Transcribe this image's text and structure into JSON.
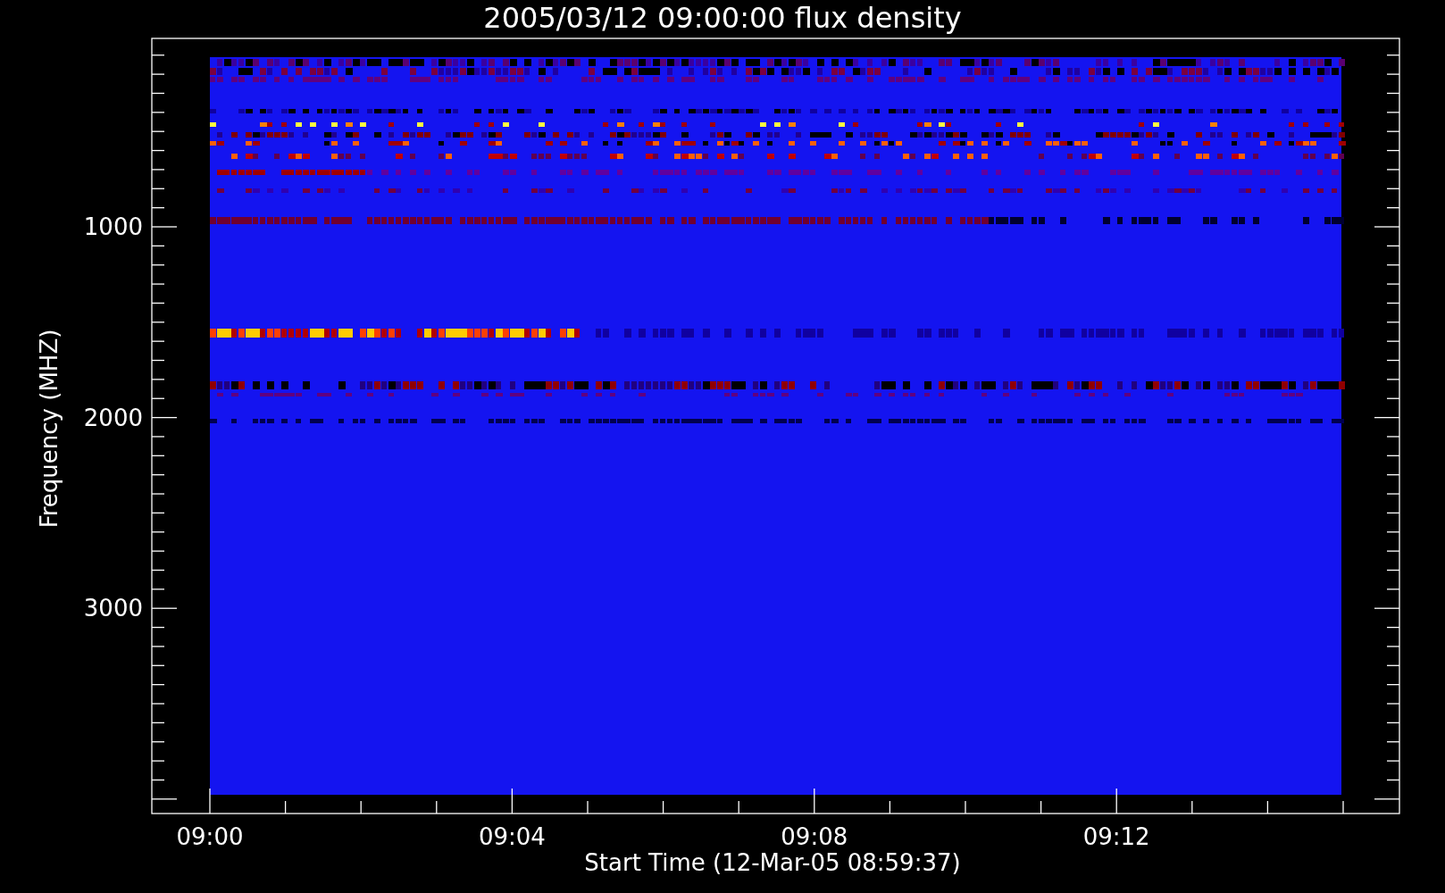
{
  "title": "2005/03/12 09:00:00 flux density",
  "y_axis": {
    "label": "Frequency (MHZ)",
    "ticks": [
      "1000",
      "2000",
      "3000"
    ]
  },
  "x_axis": {
    "label": "Start Time (12-Mar-05 08:59:37)",
    "ticks": [
      "09:00",
      "09:04",
      "09:08",
      "09:12"
    ]
  }
}
